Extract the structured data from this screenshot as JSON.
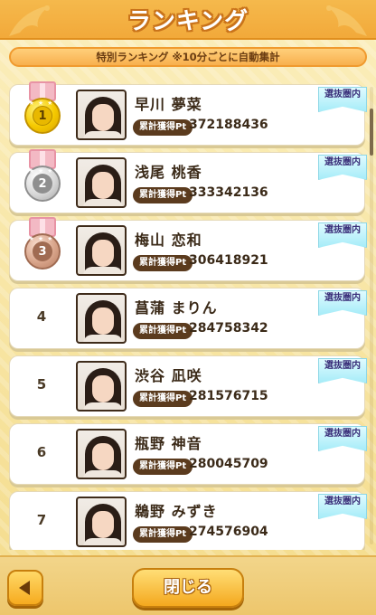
{
  "header": {
    "title": "ランキング"
  },
  "subtitle": "特別ランキング ※10分ごとに自動集計",
  "colors": {
    "header": "#f2a93a",
    "accent": "#5b3b1e",
    "badge": "#a6ecf8"
  },
  "pt_label": "累計獲得Pt",
  "rows": [
    {
      "rank": "1",
      "medal": "gold",
      "name": "早川 夢菜",
      "points": "372188436",
      "badge": "選抜圏内"
    },
    {
      "rank": "2",
      "medal": "silver",
      "name": "浅尾 桃香",
      "points": "333342136",
      "badge": "選抜圏内"
    },
    {
      "rank": "3",
      "medal": "bronze",
      "name": "梅山 恋和",
      "points": "306418921",
      "badge": "選抜圏内"
    },
    {
      "rank": "4",
      "medal": "",
      "name": "菖蒲 まりん",
      "points": "284758342",
      "badge": "選抜圏内"
    },
    {
      "rank": "5",
      "medal": "",
      "name": "渋谷 凪咲",
      "points": "281576715",
      "badge": "選抜圏内"
    },
    {
      "rank": "6",
      "medal": "",
      "name": "瓶野 神音",
      "points": "280045709",
      "badge": "選抜圏内"
    },
    {
      "rank": "7",
      "medal": "",
      "name": "鵜野 みずき",
      "points": "274576904",
      "badge": "選抜圏内"
    }
  ],
  "footer": {
    "close_label": "閉じる",
    "back_icon": "triangle-left-icon"
  }
}
